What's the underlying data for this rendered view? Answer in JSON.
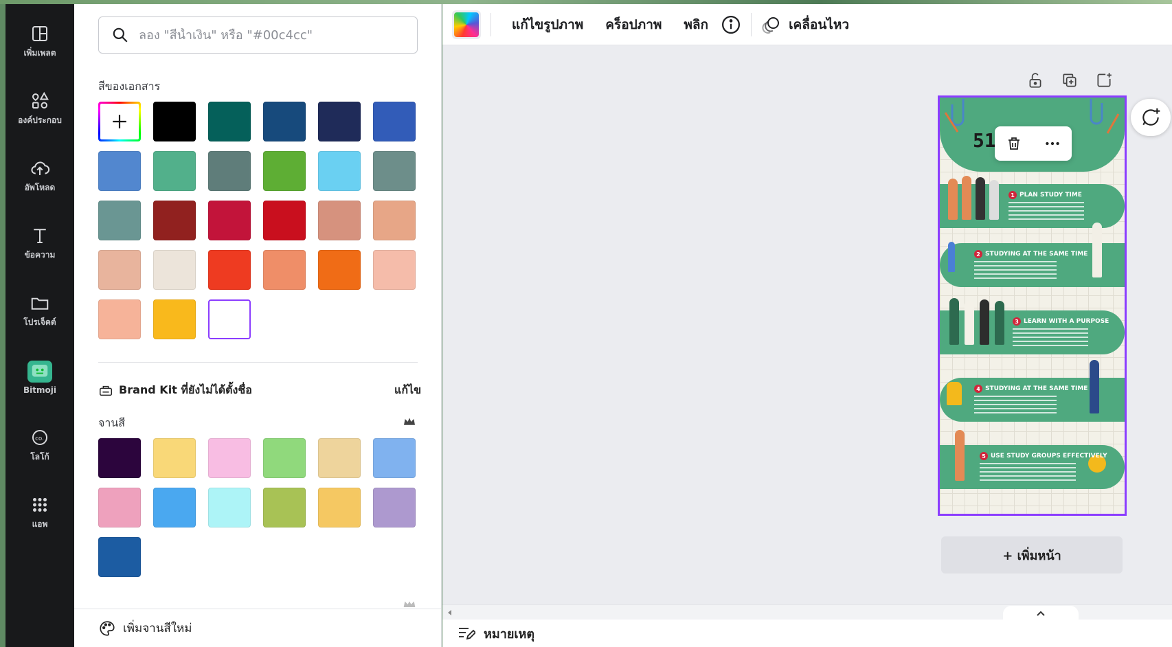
{
  "rail": {
    "items": [
      {
        "label": "เพิ่มเพลต",
        "icon": "template-icon"
      },
      {
        "label": "องค์ประกอบ",
        "icon": "elements-icon"
      },
      {
        "label": "อัพโหลด",
        "icon": "upload-cloud-icon"
      },
      {
        "label": "ข้อความ",
        "icon": "text-icon"
      },
      {
        "label": "โปรเจ็คต์",
        "icon": "folder-icon"
      },
      {
        "label": "Bitmoji",
        "icon": "bitmoji-icon"
      },
      {
        "label": "โลโก้",
        "icon": "logo-icon"
      },
      {
        "label": "แอพ",
        "icon": "apps-grid-icon"
      }
    ]
  },
  "panel": {
    "search_placeholder": "ลอง \"สีน้ำเงิน\" หรือ \"#00c4cc\"",
    "document_colors_title": "สีของเอกสาร",
    "document_colors": [
      "#000000",
      "#05605a",
      "#174a7c",
      "#1f2b59",
      "#325cb8",
      "#5287cf",
      "#52b08b",
      "#5f7d7a",
      "#5eae34",
      "#6ad0f2",
      "#6d8e8a",
      "#6a9693",
      "#91211f",
      "#c2143a",
      "#c90f1e",
      "#d6927e",
      "#e7a687",
      "#e8b49d",
      "#ece4da",
      "#ee3b21",
      "#ef8e68",
      "#f06c16",
      "#f5bcaa",
      "#f6b399",
      "#f9b91c",
      "#ffffff"
    ],
    "brand_kit_title": "Brand Kit ที่ยังไม่ได้ตั้งชื่อ",
    "brand_kit_edit": "แก้ไข",
    "palette_title": "จานสี",
    "palette_colors": [
      "#2c053d",
      "#f9d878",
      "#f8bde3",
      "#90d97c",
      "#eed49c",
      "#80b2ef",
      "#eea1bd",
      "#4aa8f0",
      "#adf4f7",
      "#a8c255",
      "#f5c862",
      "#ad99cf",
      "#1c5ca2"
    ],
    "add_palette_label": "เพิ่มจานสีใหม่"
  },
  "toolbar": {
    "edit_image": "แก้ไขรูปภาพ",
    "crop": "คร็อปภาพ",
    "flip": "พลิก",
    "animate": "เคลื่อนไหว"
  },
  "design": {
    "title": "51        SS",
    "rows": [
      {
        "num": "1",
        "title": "PLAN STUDY TIME"
      },
      {
        "num": "2",
        "title": "STUDYING AT THE SAME TIME"
      },
      {
        "num": "3",
        "title": "LEARN WITH A PURPOSE"
      },
      {
        "num": "4",
        "title": "STUDYING AT THE SAME TIME"
      },
      {
        "num": "5",
        "title": "USE STUDY GROUPS EFFECTIVELY"
      }
    ]
  },
  "add_page_label": "+ เพิ่มหน้า",
  "notes_label": "หมายเหตุ"
}
